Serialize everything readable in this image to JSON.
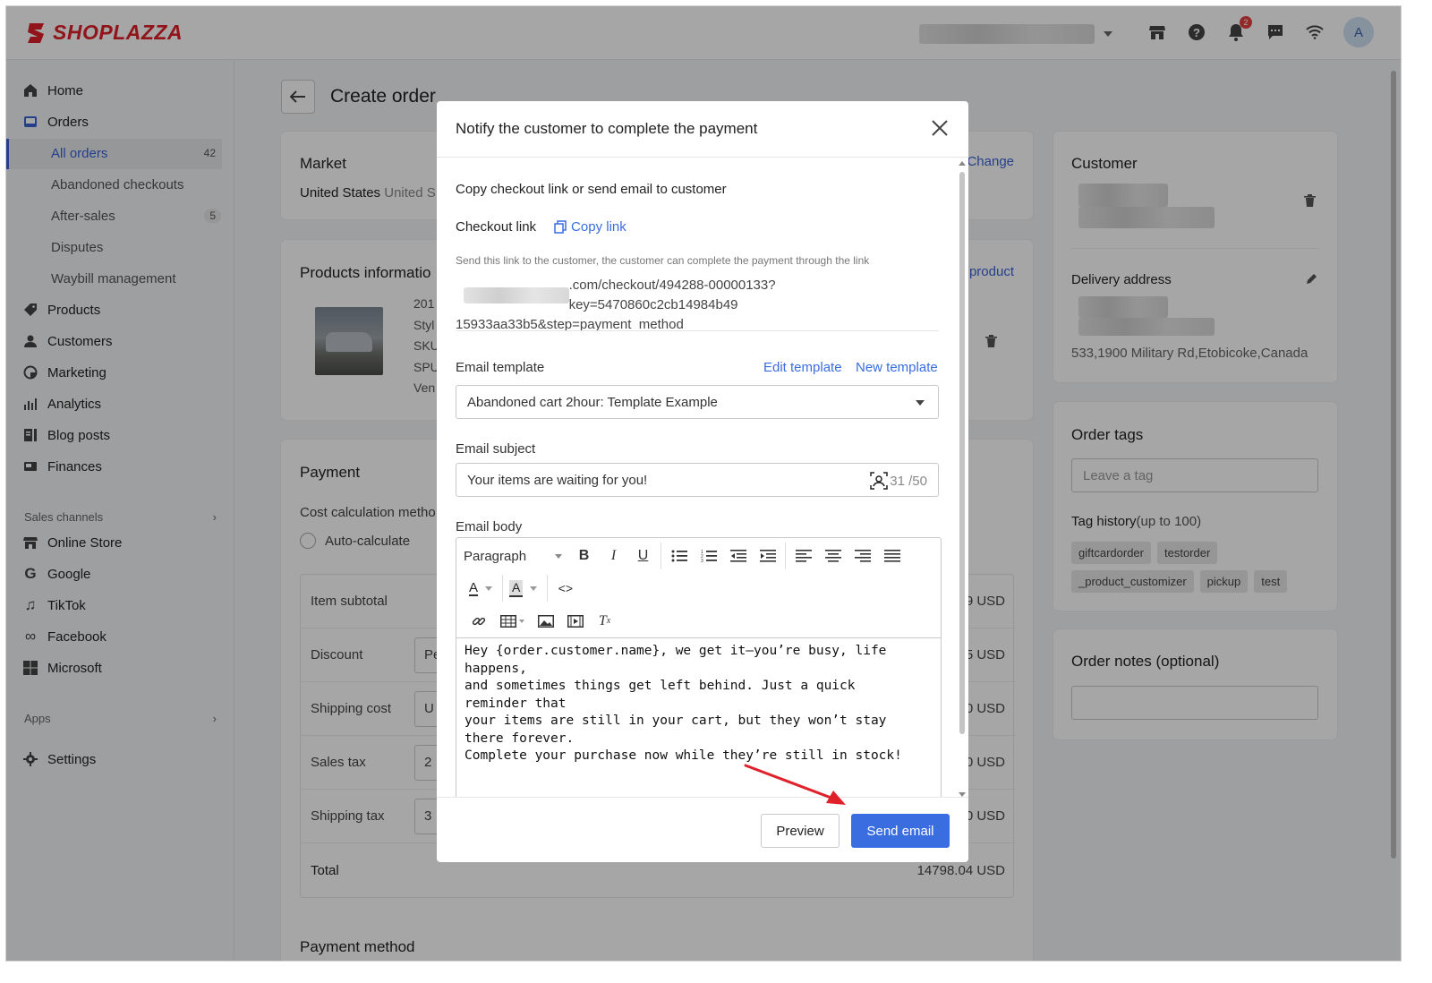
{
  "brand": {
    "name": "SHOPLAZZA",
    "color": "#e0202a"
  },
  "topbar": {
    "notification_count": "2",
    "avatar_initial": "A"
  },
  "sidebar": {
    "items": [
      {
        "label": "Home",
        "icon": "home-icon"
      },
      {
        "label": "Orders",
        "icon": "orders-icon"
      },
      {
        "label": "Products",
        "icon": "tag-icon"
      },
      {
        "label": "Customers",
        "icon": "person-icon"
      },
      {
        "label": "Marketing",
        "icon": "marketing-icon"
      },
      {
        "label": "Analytics",
        "icon": "bar-chart-icon"
      },
      {
        "label": "Blog posts",
        "icon": "blog-icon"
      },
      {
        "label": "Finances",
        "icon": "finance-icon"
      }
    ],
    "orders_sub": [
      {
        "label": "All orders",
        "count": "42"
      },
      {
        "label": "Abandoned checkouts",
        "count": ""
      },
      {
        "label": "After-sales",
        "count": "5"
      },
      {
        "label": "Disputes",
        "count": ""
      },
      {
        "label": "Waybill management",
        "count": ""
      }
    ],
    "sales_channels_label": "Sales channels",
    "channels": [
      {
        "label": "Online Store",
        "icon": "store-icon"
      },
      {
        "label": "Google",
        "icon": "google-icon"
      },
      {
        "label": "TikTok",
        "icon": "tiktok-icon"
      },
      {
        "label": "Facebook",
        "icon": "meta-icon"
      },
      {
        "label": "Microsoft",
        "icon": "microsoft-icon"
      }
    ],
    "apps_label": "Apps",
    "settings_label": "Settings"
  },
  "page": {
    "title": "Create order",
    "market": {
      "heading": "Market",
      "value": "United States",
      "sub": "United S",
      "change": "Change"
    },
    "products": {
      "heading": "Products informatio",
      "add": "product",
      "lines": [
        "201",
        "Styl",
        "SKU",
        "SPU",
        "Ven"
      ]
    },
    "payment": {
      "heading": "Payment",
      "calc_label": "Cost calculation metho",
      "auto_label": "Auto-calculate",
      "rows": [
        {
          "label": "Item subtotal",
          "input": "",
          "value": "9 USD"
        },
        {
          "label": "Discount",
          "input": "Pe",
          "value": "5 USD"
        },
        {
          "label": "Shipping cost",
          "input": "U",
          "value": "0 USD"
        },
        {
          "label": "Sales tax",
          "input": "2",
          "value": "0 USD"
        },
        {
          "label": "Shipping tax",
          "input": "3",
          "value": "0 USD"
        }
      ],
      "total_label": "Total",
      "total_value": "14798.04 USD",
      "method_heading": "Payment method"
    },
    "customer": {
      "heading": "Customer",
      "delivery_heading": "Delivery address",
      "address": "533,1900 Military Rd,Etobicoke,Canada"
    },
    "tags": {
      "heading": "Order tags",
      "placeholder": "Leave a tag",
      "history_label": "Tag history",
      "history_note": "(up to 100)",
      "items": [
        "giftcardorder",
        "testorder",
        "_product_customizer",
        "pickup",
        "test"
      ]
    },
    "notes": {
      "heading": "Order notes (optional)"
    }
  },
  "modal": {
    "title": "Notify the customer to complete the payment",
    "intro": "Copy checkout link or send email to customer",
    "checkout_label": "Checkout link",
    "copy_link": "Copy link",
    "hint": "Send this link to the customer, the customer can complete the payment through the link",
    "link_line1": ".com/checkout/494288-00000133?key=5470860c2cb14984b49",
    "link_line2": "15933aa33b5&step=payment_method",
    "template_label": "Email template",
    "edit_template": "Edit template",
    "new_template": "New template",
    "template_value": "Abandoned cart 2hour: Template Example",
    "subject_label": "Email subject",
    "subject_value": "Your items are waiting for you!",
    "subject_count": "31 /50",
    "body_label": "Email body",
    "paragraph_select": "Paragraph",
    "body_lines": [
      "Hey {order.customer.name}, we get it—you’re busy, life happens,",
      "and sometimes things get left behind. Just a quick reminder that",
      "your items are still in your cart, but they won’t stay there forever.",
      "Complete your purchase now while they’re still in stock!"
    ],
    "preview_btn": "Preview",
    "send_btn": "Send email",
    "accent": "#3a6de0",
    "arrow_color": "#e0202a"
  }
}
